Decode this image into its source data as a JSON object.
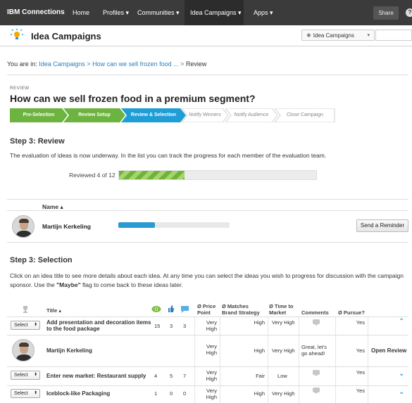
{
  "topnav": {
    "brand": "IBM Connections",
    "items": [
      "Home",
      "Profiles ▾",
      "Communities ▾",
      "Idea Campaigns ▾",
      "Apps ▾"
    ],
    "share": "Share"
  },
  "app": {
    "title": "Idea Campaigns",
    "scope_selector": "Idea Campaigns"
  },
  "breadcrumb": {
    "prefix": "You are in:",
    "link1": "Idea Campaigns",
    "sep1": ">",
    "link2": "How can we sell frozen food ...",
    "sep2": ">",
    "current": "Review"
  },
  "page": {
    "kicker": "REVIEW",
    "title": "How can we sell frozen food in a premium segment?"
  },
  "wizard": {
    "steps": [
      "Pre-Selection",
      "Review Setup",
      "Review & Selection",
      "Notify Winners",
      "Notify Audience",
      "Close Campaign"
    ],
    "colors": {
      "done": "#6db33f",
      "active": "#1f9dd6",
      "todo": "#ffffff"
    }
  },
  "review": {
    "heading": "Step 3: Review",
    "description": "The evaluation of ideas is now underway. In the list you can track the progress for each member of the evaluation team.",
    "progress_label": "Reviewed 4 of 12",
    "progress_fraction": 0.333,
    "name_header": "Name ▴",
    "members": [
      {
        "name": "Martijn Kerkeling",
        "progress_fraction": 0.33,
        "action": "Send a Reminder"
      }
    ]
  },
  "selection": {
    "heading": "Step 3: Selection",
    "description_1": "Click on an idea title to see more details about each idea. At any time you can select the ideas you wish to progress for discussion with the campaign sponsor. Use the ",
    "description_bold": "\"Maybe\"",
    "description_2": " flag to come back to these ideas later.",
    "columns": {
      "title": "Title ▴",
      "price_1": "Ø Price",
      "price_2": "Point",
      "brand_1": "Ø Matches",
      "brand_2": "Brand Strategy",
      "market_1": "Ø Time to",
      "market_2": "Market",
      "comments": "Comments",
      "pursue": "Ø Pursue?"
    },
    "select_label": "Select",
    "rows": [
      {
        "title_1": "Add presentation and decoration items",
        "title_2": "to the food package",
        "views": "15",
        "likes": "3",
        "comments_count": "3",
        "price_1": "Very",
        "price_2": "High",
        "brand": "High",
        "market": "Very High",
        "pursue": "Yes"
      },
      {
        "title_1": "Enter new market: Restaurant supply",
        "title_2": "",
        "views": "4",
        "likes": "5",
        "comments_count": "7",
        "price_1": "Very",
        "price_2": "High",
        "brand": "Fair",
        "market": "Low",
        "pursue": "Yes"
      },
      {
        "title_1": "Iceblock-like Packaging",
        "title_2": "",
        "views": "1",
        "likes": "0",
        "comments_count": "0",
        "price_1": "Very",
        "price_2": "High",
        "brand": "High",
        "market": "Very High",
        "pursue": "Yes"
      }
    ],
    "expanded": {
      "name": "Martijn Kerkeling",
      "price_1": "Very",
      "price_2": "High",
      "brand": "High",
      "market": "Very High",
      "comment_1": "Great, let's",
      "comment_2": "go ahead!",
      "pursue": "Yes",
      "action": "Open Review"
    }
  }
}
